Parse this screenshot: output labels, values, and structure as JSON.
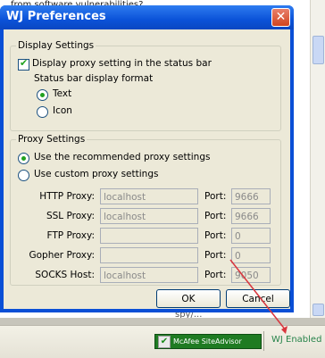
{
  "background": {
    "text_top": "from software vulnerabilities?",
    "text_bottom": "spy/..."
  },
  "dialog": {
    "title": "WJ Preferences",
    "close_glyph": "✕",
    "display_settings": {
      "legend": "Display Settings",
      "show_proxy_label": "Display proxy setting in the status bar",
      "show_proxy_checked": true,
      "format_label": "Status bar display format",
      "format_options": [
        {
          "label": "Text",
          "selected": true
        },
        {
          "label": "Icon",
          "selected": false
        }
      ]
    },
    "proxy_settings": {
      "legend": "Proxy Settings",
      "mode_options": [
        {
          "label": "Use the recommended proxy settings",
          "selected": true
        },
        {
          "label": "Use custom proxy settings",
          "selected": false
        }
      ],
      "port_label": "Port:",
      "rows": [
        {
          "label": "HTTP Proxy:",
          "host": "localhost",
          "port": "9666"
        },
        {
          "label": "SSL Proxy:",
          "host": "localhost",
          "port": "9666"
        },
        {
          "label": "FTP Proxy:",
          "host": "",
          "port": "0"
        },
        {
          "label": "Gopher Proxy:",
          "host": "",
          "port": "0"
        },
        {
          "label": "SOCKS Host:",
          "host": "localhost",
          "port": "9050"
        }
      ]
    },
    "ok_label": "OK",
    "cancel_label": "Cancel"
  },
  "status_bar": {
    "siteadvisor_label": "McAfee SiteAdvisor",
    "wj_status": "WJ Enabled"
  },
  "annotation": {
    "color": "#d9363e"
  }
}
